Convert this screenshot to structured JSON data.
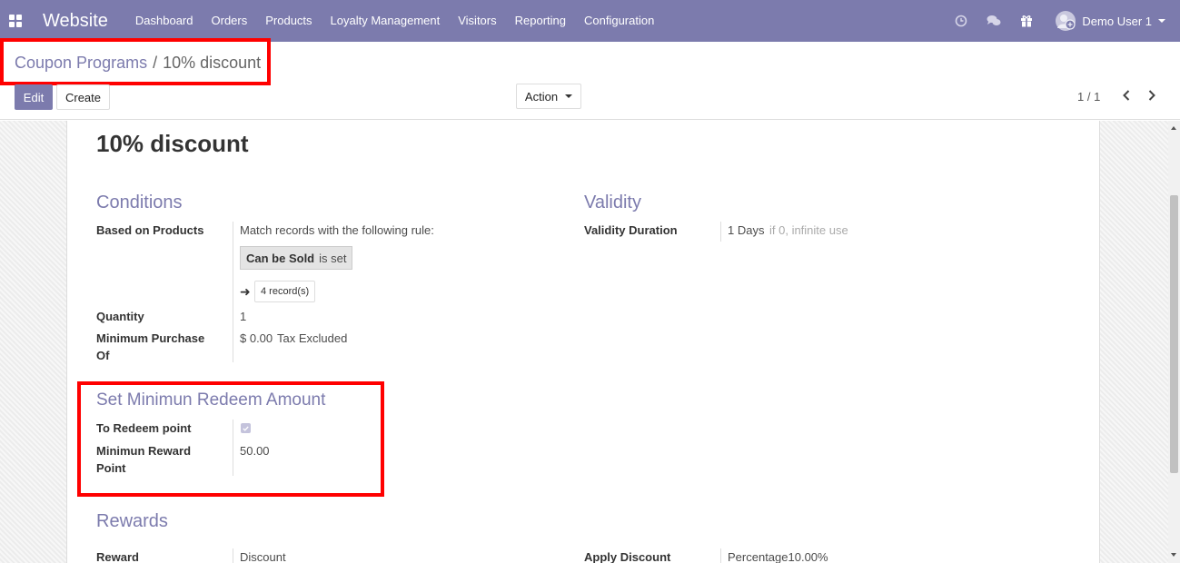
{
  "navbar": {
    "brand": "Website",
    "menu": [
      "Dashboard",
      "Orders",
      "Products",
      "Loyalty Management",
      "Visitors",
      "Reporting",
      "Configuration"
    ],
    "user_name": "Demo User 1",
    "icons": [
      "clock-icon",
      "chat-icon",
      "gift-icon",
      "avatar"
    ]
  },
  "breadcrumb": {
    "parent": "Coupon Programs",
    "separator": "/",
    "current": "10% discount"
  },
  "toolbar": {
    "edit_label": "Edit",
    "create_label": "Create",
    "action_label": "Action",
    "pager": "1 / 1"
  },
  "record": {
    "title": "10% discount",
    "conditions": {
      "heading": "Conditions",
      "based_on_products_label": "Based on Products",
      "rule_text": "Match records with the following rule:",
      "rule_field": "Can be Sold",
      "rule_op": "is set",
      "records_link": "4 record(s)",
      "quantity_label": "Quantity",
      "quantity_value": "1",
      "min_purchase_label_1": "Minimum Purchase",
      "min_purchase_label_2": "Of",
      "min_purchase_value": "$ 0.00",
      "tax_mode": "Tax Excluded"
    },
    "validity": {
      "heading": "Validity",
      "duration_label": "Validity Duration",
      "duration_value": "1 Days",
      "duration_hint": "if 0, infinite use"
    },
    "redeem": {
      "heading": "Set Minimun Redeem Amount",
      "to_redeem_label": "To Redeem point",
      "to_redeem_checked": true,
      "min_reward_label_1": "Minimun Reward",
      "min_reward_label_2": "Point",
      "min_reward_value": "50.00"
    },
    "rewards": {
      "heading": "Rewards",
      "reward_label": "Reward",
      "reward_value": "Discount",
      "apply_discount_label": "Apply Discount",
      "apply_discount_value": "Percentage10.00%"
    }
  },
  "colors": {
    "brand": "#7c7bad",
    "highlight": "#ff0000"
  }
}
